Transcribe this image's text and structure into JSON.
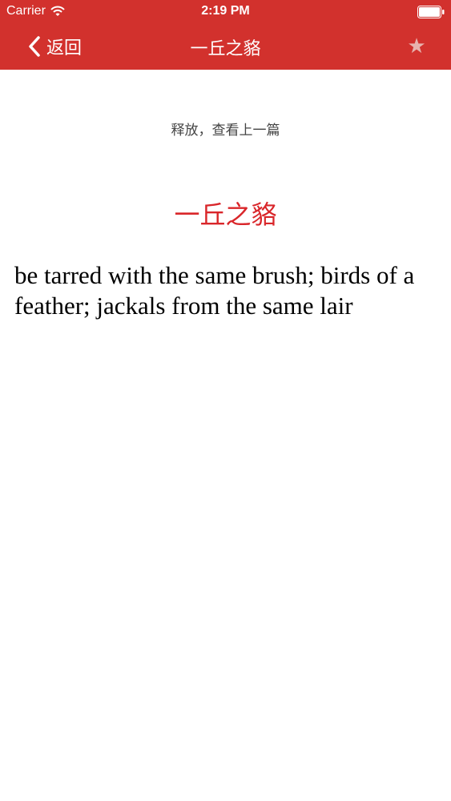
{
  "status_bar": {
    "carrier": "Carrier",
    "time": "2:19 PM",
    "wifi_icon": "wifi-icon",
    "battery_icon": "battery-icon"
  },
  "nav": {
    "back_label": "返回",
    "back_icon": "chevron-left-icon",
    "title": "一丘之貉",
    "star_icon": "star-icon"
  },
  "content": {
    "pull_hint": "释放，查看上一篇",
    "entry_title": "一丘之貉",
    "entry_body": "be tarred with the same brush; birds of a feather; jackals from the same lair"
  },
  "colors": {
    "nav_background": "#d2312d",
    "entry_title": "#d9262a",
    "star": "#e7b3ae"
  }
}
